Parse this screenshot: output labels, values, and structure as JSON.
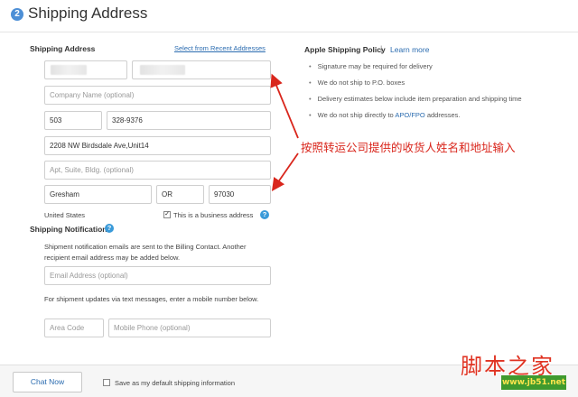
{
  "header": {
    "step": "2",
    "title": "Shipping Address"
  },
  "address": {
    "label": "Shipping Address",
    "recent_link": "Select from Recent Addresses",
    "company_placeholder": "Company Name (optional)",
    "phone_area": "503",
    "phone_number": "328-9376",
    "street": "2208 NW Birdsdale Ave,Unit14",
    "apt_placeholder": "Apt, Suite, Bldg. (optional)",
    "city": "Gresham",
    "state": "OR",
    "zip": "97030",
    "country": "United States",
    "business_checkbox": "This is a business address",
    "business_checked": true
  },
  "policy": {
    "title": "Apple Shipping Policy",
    "separator": "|",
    "learn_more": "Learn more",
    "items": [
      "Signature may be required for delivery",
      "We do not ship to P.O. boxes",
      "Delivery estimates below include item preparation and shipping time"
    ],
    "apo_item": {
      "before": "We do not ship directly to ",
      "link": "APO/FPO",
      "after": " addresses."
    }
  },
  "notifications": {
    "label": "Shipping Notifications",
    "email_text": "Shipment notification emails are sent to the Billing Contact. Another recipient email address may be added below.",
    "email_placeholder": "Email Address (optional)",
    "sms_text": "For shipment updates via text messages, enter a mobile number below.",
    "area_code_placeholder": "Area Code",
    "mobile_placeholder": "Mobile Phone (optional)"
  },
  "annotation": "按照转运公司提供的收货人姓名和地址输入",
  "footer": {
    "chat_label": "Chat Now",
    "save_default_label": "Save as my default shipping information",
    "save_default_checked": false
  },
  "watermark": {
    "text": "脚本之家",
    "url": "www.jb51.net"
  },
  "colors": {
    "link": "#2b6cb0",
    "annotation": "#d9261c",
    "help_icon": "#3a9ad9"
  }
}
